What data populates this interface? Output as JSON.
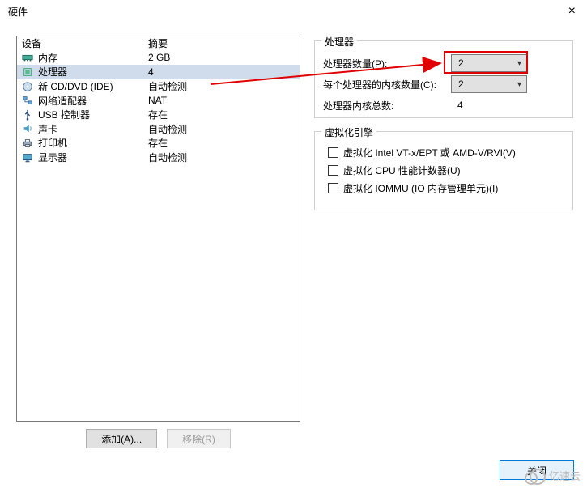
{
  "dialog": {
    "title": "硬件",
    "close_x": "×"
  },
  "hw_table": {
    "head_device": "设备",
    "head_summary": "摘要",
    "rows": [
      {
        "icon": "memory-icon",
        "device": "内存",
        "summary": "2 GB",
        "selected": false
      },
      {
        "icon": "cpu-icon",
        "device": "处理器",
        "summary": "4",
        "selected": true
      },
      {
        "icon": "cd-icon",
        "device": "新 CD/DVD (IDE)",
        "summary": "自动检测",
        "selected": false
      },
      {
        "icon": "network-icon",
        "device": "网络适配器",
        "summary": "NAT",
        "selected": false
      },
      {
        "icon": "usb-icon",
        "device": "USB 控制器",
        "summary": "存在",
        "selected": false
      },
      {
        "icon": "sound-icon",
        "device": "声卡",
        "summary": "自动检测",
        "selected": false
      },
      {
        "icon": "printer-icon",
        "device": "打印机",
        "summary": "存在",
        "selected": false
      },
      {
        "icon": "display-icon",
        "device": "显示器",
        "summary": "自动检测",
        "selected": false
      }
    ],
    "add_label": "添加(A)...",
    "remove_label": "移除(R)"
  },
  "proc_group": {
    "legend": "处理器",
    "count_label": "处理器数量(P):",
    "count_value": "2",
    "cores_label": "每个处理器的内核数量(C):",
    "cores_value": "2",
    "total_label": "处理器内核总数:",
    "total_value": "4"
  },
  "virt_group": {
    "legend": "虚拟化引擎",
    "vt_label": "虚拟化 Intel VT-x/EPT 或 AMD-V/RVI(V)",
    "perf_label": "虚拟化 CPU 性能计数器(U)",
    "iommu_label": "虚拟化 IOMMU (IO 内存管理单元)(I)"
  },
  "footer": {
    "close_label": "关闭"
  },
  "watermark": "亿速云"
}
